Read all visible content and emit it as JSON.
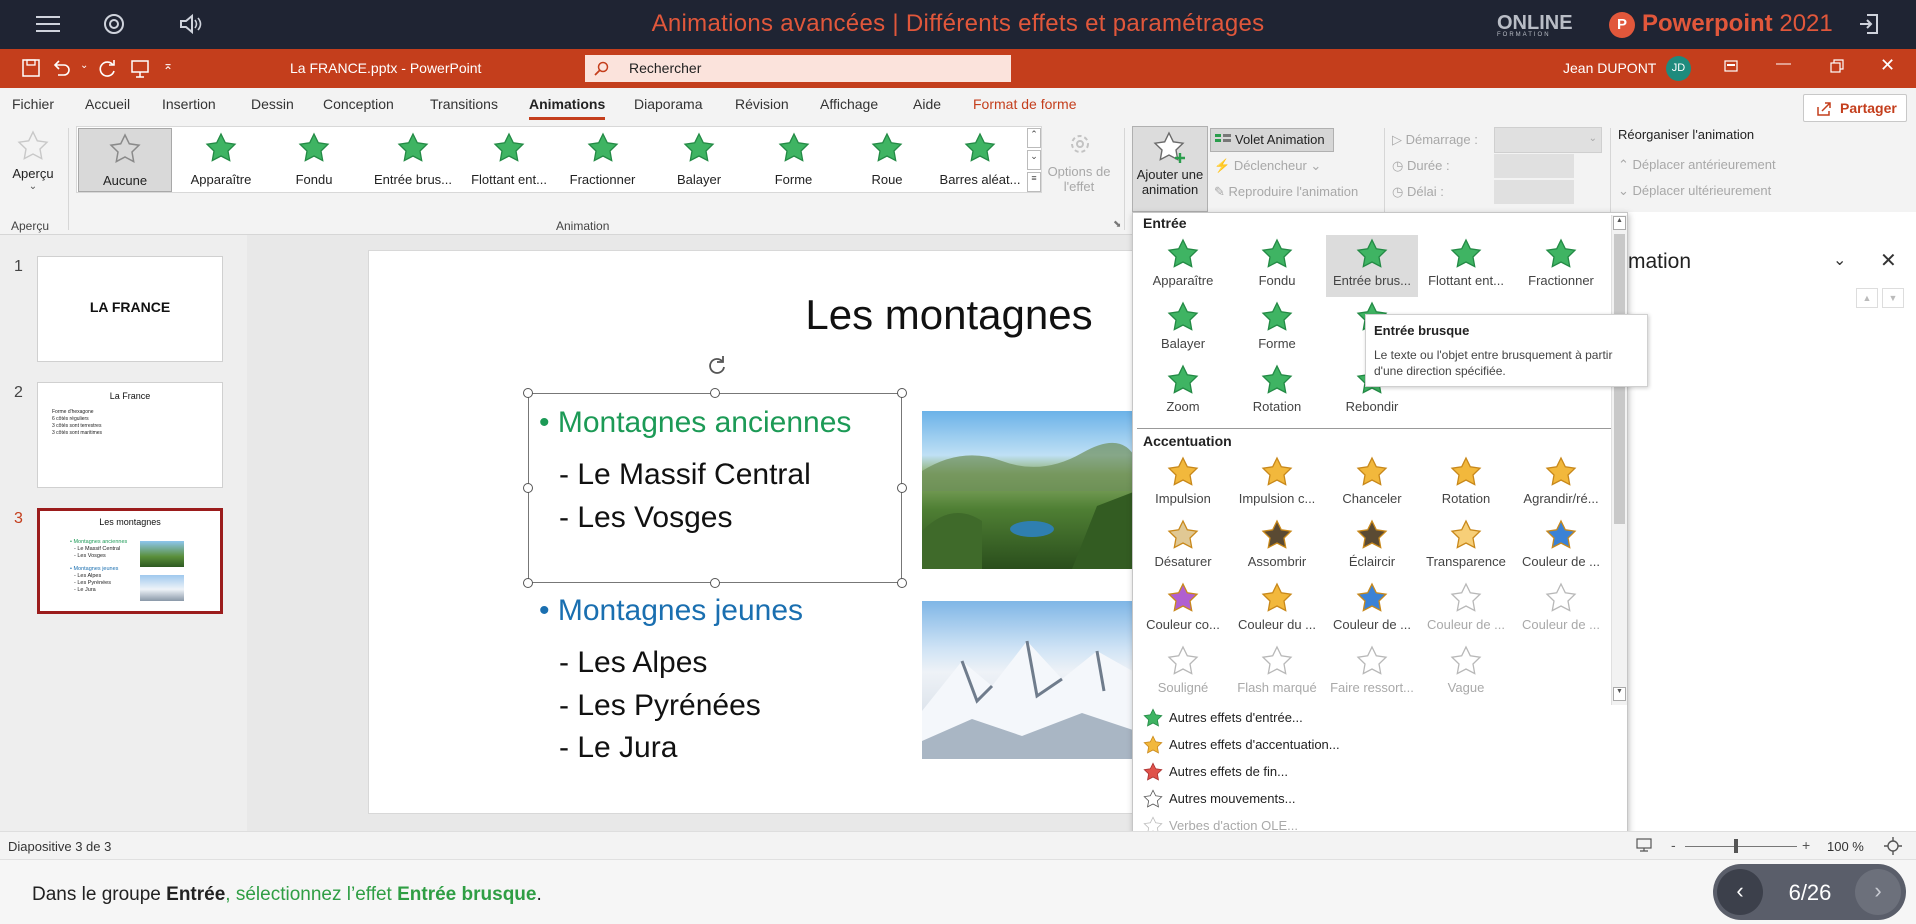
{
  "course": {
    "title": "Animations avancées | Différents effets et paramétrages",
    "brand_online": "ONLINE",
    "brand_online_sub": "FORMATION",
    "brand_app": "Powerpoint",
    "brand_year": "2021",
    "brand_logo": "P"
  },
  "titlebar": {
    "document_title": "La FRANCE.pptx - PowerPoint",
    "search_placeholder": "Rechercher",
    "user_name": "Jean DUPONT",
    "user_initials": "JD"
  },
  "tabs": [
    "Fichier",
    "Accueil",
    "Insertion",
    "Dessin",
    "Conception",
    "Transitions",
    "Animations",
    "Diaporama",
    "Révision",
    "Affichage",
    "Aide",
    "Format de forme"
  ],
  "active_tab": "Animations",
  "share_label": "Partager",
  "ribbon": {
    "preview_label": "Aperçu",
    "preview_group": "Aperçu",
    "animation_group": "Animation",
    "gallery": [
      "Aucune",
      "Apparaître",
      "Fondu",
      "Entrée brus...",
      "Flottant ent...",
      "Fractionner",
      "Balayer",
      "Forme",
      "Roue",
      "Barres aléat..."
    ],
    "effect_options_line1": "Options de",
    "effect_options_line2": "l'effet",
    "add_animation_line1": "Ajouter une",
    "add_animation_line2": "animation",
    "animation_pane": "Volet Animation",
    "trigger": "Déclencheur",
    "painter": "Reproduire l'animation",
    "start": "Démarrage :",
    "duration": "Durée :",
    "delay": "Délai :",
    "reorder": "Réorganiser l'animation",
    "move_earlier": "Déplacer antérieurement",
    "move_later": "Déplacer ultérieurement"
  },
  "slides": [
    {
      "num": "1",
      "title": "LA FRANCE"
    },
    {
      "num": "2",
      "title": "La France",
      "bullets": [
        "Forme d'hexagone",
        "6 côtés réguliers",
        "3 côtés sont terrestres",
        "3 côtés sont maritimes"
      ]
    },
    {
      "num": "3",
      "title": "Les montagnes",
      "bullets_a": [
        "• Montagnes anciennes",
        "- Le Massif Central",
        "- Les Vosges"
      ],
      "bullets_b": [
        "• Montagnes jeunes",
        "- Les Alpes",
        "- Les Pyrénées",
        "- Le Jura"
      ]
    }
  ],
  "slide": {
    "title": "Les montagnes",
    "heading1": "• Montagnes anciennes",
    "item1a": "- Le Massif Central",
    "item1b": "- Les Vosges",
    "heading2": "• Montagnes jeunes",
    "item2a": "- Les Alpes",
    "item2b": "- Les Pyrénées",
    "item2c": "- Le Jura"
  },
  "dropdown": {
    "entree_title": "Entrée",
    "entree": [
      "Apparaître",
      "Fondu",
      "Entrée brus...",
      "Flottant ent...",
      "Fractionner",
      "Balayer",
      "Forme",
      "R",
      "",
      "",
      "Zoom",
      "Rotation",
      "Rebondir"
    ],
    "accent_title": "Accentuation",
    "accent": [
      "Impulsion",
      "Impulsion c...",
      "Chanceler",
      "Rotation",
      "Agrandir/ré...",
      "Désaturer",
      "Assombrir",
      "Éclaircir",
      "Transparence",
      "Couleur de ...",
      "Couleur co...",
      "Couleur du ...",
      "Couleur de ...",
      "Couleur de ...",
      "Couleur de ...",
      "Souligné",
      "Flash marqué",
      "Faire ressort...",
      "Vague"
    ],
    "more": [
      "Autres effets d'entrée...",
      "Autres effets d'accentuation...",
      "Autres effets de fin...",
      "Autres mouvements...",
      "Verbes d'action OLE..."
    ]
  },
  "tooltip": {
    "title": "Entrée brusque",
    "description": "Le texte ou l'objet entre brusquement à partir d'une direction spécifiée."
  },
  "animation_pane_title": "mation",
  "status": {
    "slide_info": "Diapositive 3 de 3",
    "zoom": "100 %"
  },
  "instruction": {
    "p1": "Dans le groupe ",
    "p2": "Entrée",
    "p3": ", sélectionnez l’effet ",
    "p4": "Entrée brusque",
    "p5": "."
  },
  "pager": "6/26",
  "colors": {
    "accent": "#c43e1c",
    "header": "#1f2433",
    "green_heading": "#1c9a56",
    "blue_heading": "#1a6fb0"
  }
}
